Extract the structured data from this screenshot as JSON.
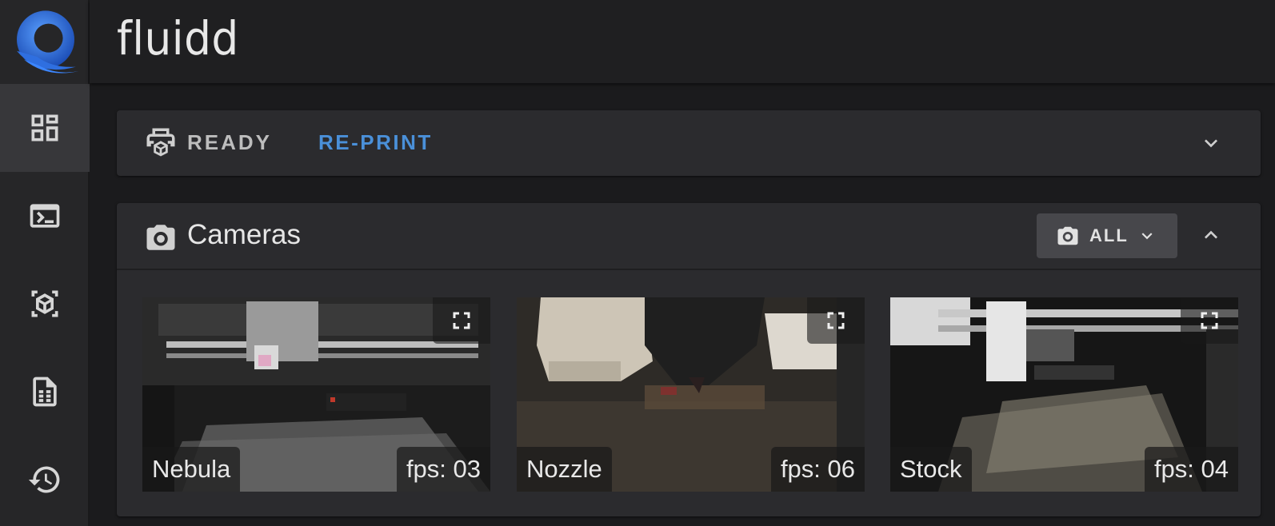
{
  "app": {
    "brand": "fluidd"
  },
  "sidebar": {
    "items": [
      {
        "icon": "dashboard-icon",
        "active": true
      },
      {
        "icon": "console-icon",
        "active": false
      },
      {
        "icon": "cube-scan-icon",
        "active": false
      },
      {
        "icon": "file-document-icon",
        "active": false
      },
      {
        "icon": "history-icon",
        "active": false
      }
    ]
  },
  "status": {
    "state": "READY",
    "reprint_label": "RE-PRINT"
  },
  "cameras": {
    "title": "Cameras",
    "filter_label": "ALL",
    "items": [
      {
        "name": "Nebula",
        "fps": "fps: 03"
      },
      {
        "name": "Nozzle",
        "fps": "fps: 06"
      },
      {
        "name": "Stock",
        "fps": "fps: 04"
      }
    ]
  },
  "colors": {
    "accent": "#4a90d9",
    "background": "#1b1b1d",
    "card": "#2b2b2e",
    "sidebar": "#262628"
  }
}
